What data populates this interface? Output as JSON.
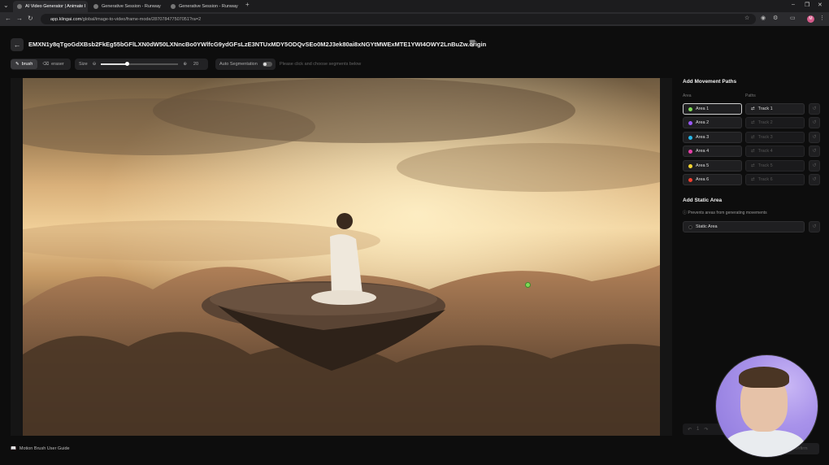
{
  "browser": {
    "tabs": [
      {
        "label": "AI Video Generator | Animate I",
        "active": true
      },
      {
        "label": "Generative Session - Runway",
        "active": false
      },
      {
        "label": "Generative Session - Runway",
        "active": false
      }
    ],
    "new_tab": "+",
    "url_host": "app.klingai.com",
    "url_path": "/global/image-to-video/frame-mode/287078477507051?ra=2",
    "profile_initial": "M"
  },
  "header": {
    "back_icon": "←",
    "file_title": "EMXN1y8qTgoGdXBsb2FkEg55bGFlLXN0dW50LXNncBo0YWlfcG9ydGFsLzE3NTUxMDY5ODQvSEo0M2J3ek80ai8xNGYtMWExMTE1YWI4OWY2LnBuZw.origin"
  },
  "toolbar": {
    "brush_label": "brush",
    "eraser_label": "eraser",
    "size_label": "Size",
    "size_value": "20",
    "size_fraction": 0.33,
    "auto_seg_label": "Auto Segmentation",
    "hint": "Please click and choose segments below"
  },
  "sidebar": {
    "movement_title": "Add Movement Paths",
    "col_area": "Area",
    "col_paths": "Paths",
    "rows": [
      {
        "area": "Area 1",
        "color": "#7ed957",
        "track": "Track 1",
        "selected": true,
        "track_on": true
      },
      {
        "area": "Area 2",
        "color": "#9b59ff",
        "track": "Track 2",
        "selected": false,
        "track_on": false
      },
      {
        "area": "Area 3",
        "color": "#27b6e6",
        "track": "Track 3",
        "selected": false,
        "track_on": false
      },
      {
        "area": "Area 4",
        "color": "#e63fa8",
        "track": "Track 4",
        "selected": false,
        "track_on": false
      },
      {
        "area": "Area 5",
        "color": "#f5d531",
        "track": "Track 5",
        "selected": false,
        "track_on": false
      },
      {
        "area": "Area 6",
        "color": "#f04030",
        "track": "Track 6",
        "selected": false,
        "track_on": false
      }
    ],
    "static_title": "Add Static Area",
    "static_note": "Prevents areas from generating movements",
    "static_button": "Static Area"
  },
  "footer": {
    "guide_label": "Motion Brush User Guide",
    "undo_count": "1",
    "confirm_label": "Confirm"
  }
}
